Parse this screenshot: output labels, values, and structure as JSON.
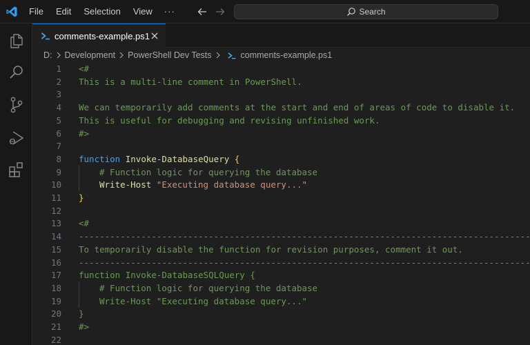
{
  "menu": {
    "file": "File",
    "edit": "Edit",
    "selection": "Selection",
    "view": "View",
    "more": "···"
  },
  "search": {
    "label": "Search"
  },
  "tab": {
    "label": "comments-example.ps1"
  },
  "breadcrumb": {
    "drive": "D:",
    "folder1": "Development",
    "folder2": "PowerShell Dev Tests",
    "file": "comments-example.ps1"
  },
  "code": {
    "l1": "<#",
    "l2": "This is a multi-line comment in PowerShell.",
    "l4": "We can temporarily add comments at the start and end of areas of code to disable it.",
    "l5": "This is useful for debugging and revising unfinished work.",
    "l6": "#>",
    "l8_kw": "function",
    "l8_fn": "Invoke-DatabaseQuery",
    "l8_br": "{",
    "l9": "# Function logic for querying the database",
    "l10_cmd": "Write-Host",
    "l10_str": "\"Executing database query...\"",
    "l11_br": "}",
    "l13": "<#",
    "l14": "------------------------------------------------------------------------------------------",
    "l15": "To temporarily disable the function for revision purposes, comment it out.",
    "l16": "------------------------------------------------------------------------------------------",
    "l17": "function Invoke-DatabaseSQLQuery {",
    "l18": "# Function logic for querying the database",
    "l19": "Write-Host \"Executing database query...\"",
    "l20": "}",
    "l21": "#>",
    "line_numbers": [
      "1",
      "2",
      "3",
      "4",
      "5",
      "6",
      "7",
      "8",
      "9",
      "10",
      "11",
      "12",
      "13",
      "14",
      "15",
      "16",
      "17",
      "18",
      "19",
      "20",
      "21",
      "22"
    ]
  },
  "colors": {
    "accent": "#0078d4",
    "comment": "#6a9955",
    "keyword": "#569cd6",
    "function": "#dcdcaa",
    "string": "#ce9178",
    "bracket": "#ffd700"
  }
}
